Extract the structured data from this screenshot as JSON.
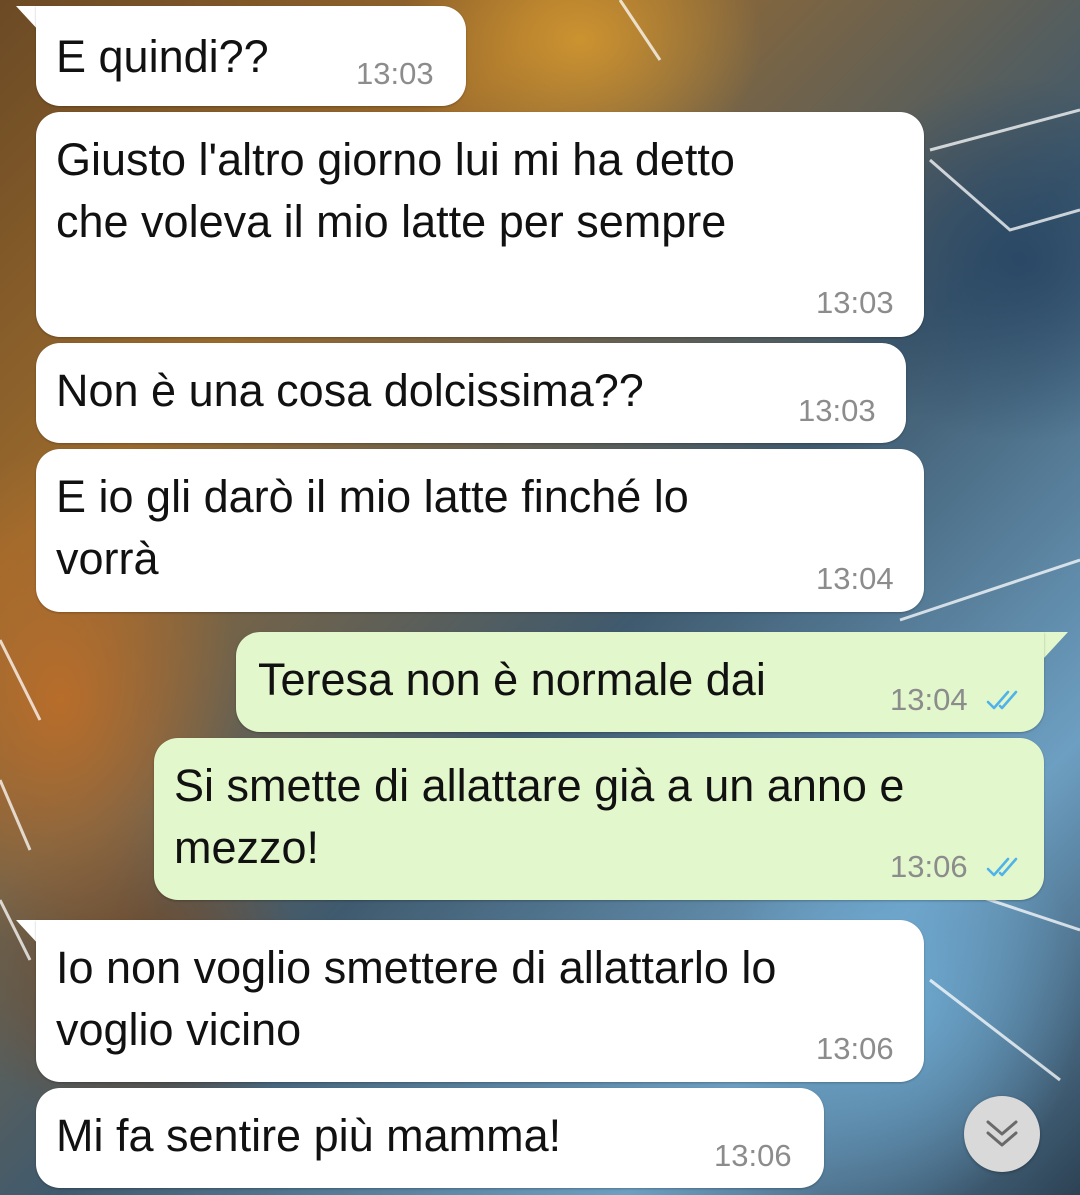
{
  "conversation": {
    "messages": [
      {
        "direction": "incoming",
        "text": [
          "E quindi??"
        ],
        "time": "13:03"
      },
      {
        "direction": "incoming",
        "text": [
          "Giusto l'altro giorno lui mi ha detto",
          "che voleva il mio latte per sempre"
        ],
        "time": "13:03"
      },
      {
        "direction": "incoming",
        "text": [
          "Non è una cosa dolcissima??"
        ],
        "time": "13:03"
      },
      {
        "direction": "incoming",
        "text": [
          "E io gli darò il mio latte finché lo",
          "vorrà"
        ],
        "time": "13:04"
      },
      {
        "direction": "outgoing",
        "text": [
          "Teresa non è normale dai"
        ],
        "time": "13:04",
        "status": "read"
      },
      {
        "direction": "outgoing",
        "text": [
          "Si smette di allattare già a un anno e",
          "mezzo!"
        ],
        "time": "13:06",
        "status": "read"
      },
      {
        "direction": "incoming",
        "text": [
          "Io non voglio smettere di allattarlo lo",
          "voglio vicino"
        ],
        "time": "13:06"
      },
      {
        "direction": "incoming",
        "text": [
          "Mi fa sentire più mamma!"
        ],
        "time": "13:06"
      }
    ]
  },
  "controls": {
    "scroll_down_icon": "double-chevron-down-icon"
  },
  "colors": {
    "incoming_bubble": "#ffffff",
    "outgoing_bubble": "#e2f7cb",
    "timestamp": "#8c8c8c",
    "read_check": "#4fb3ea"
  }
}
